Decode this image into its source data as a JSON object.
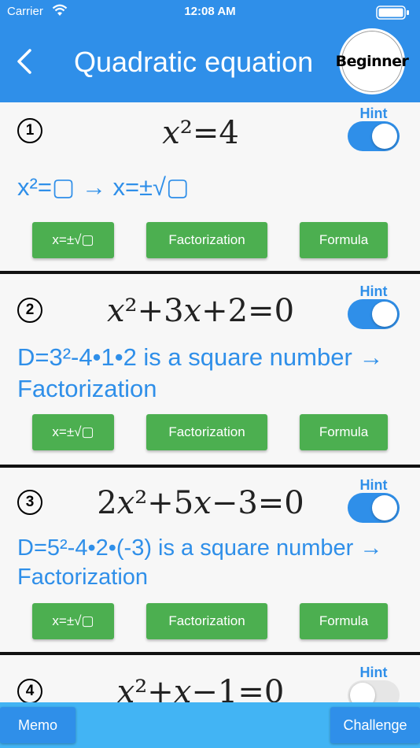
{
  "status": {
    "carrier": "Carrier",
    "time": "12:08 AM"
  },
  "header": {
    "title": "Quadratic equation",
    "level_badge": "Beginner"
  },
  "buttons": {
    "root": "x=±√▢",
    "factor": "Factorization",
    "formula": "Formula"
  },
  "problems": [
    {
      "number": "1",
      "hint_label": "Hint",
      "hint_on": true,
      "hint": "x²=▢ → x=±√▢"
    },
    {
      "number": "2",
      "hint_label": "Hint",
      "hint_on": true,
      "hint": "D=3²-4•1•2 is a square number → Factorization"
    },
    {
      "number": "3",
      "hint_label": "Hint",
      "hint_on": true,
      "hint": "D=5²-4•2•(-3) is a square number → Factorization"
    },
    {
      "number": "4",
      "hint_label": "Hint",
      "hint_on": false,
      "hint": ""
    }
  ],
  "footer": {
    "memo": "Memo",
    "challenge": "Challenge"
  },
  "colors": {
    "header": "#2f8fe9",
    "button": "#4caf50",
    "hint": "#2f8fe9",
    "footer": "#42b4f4"
  }
}
